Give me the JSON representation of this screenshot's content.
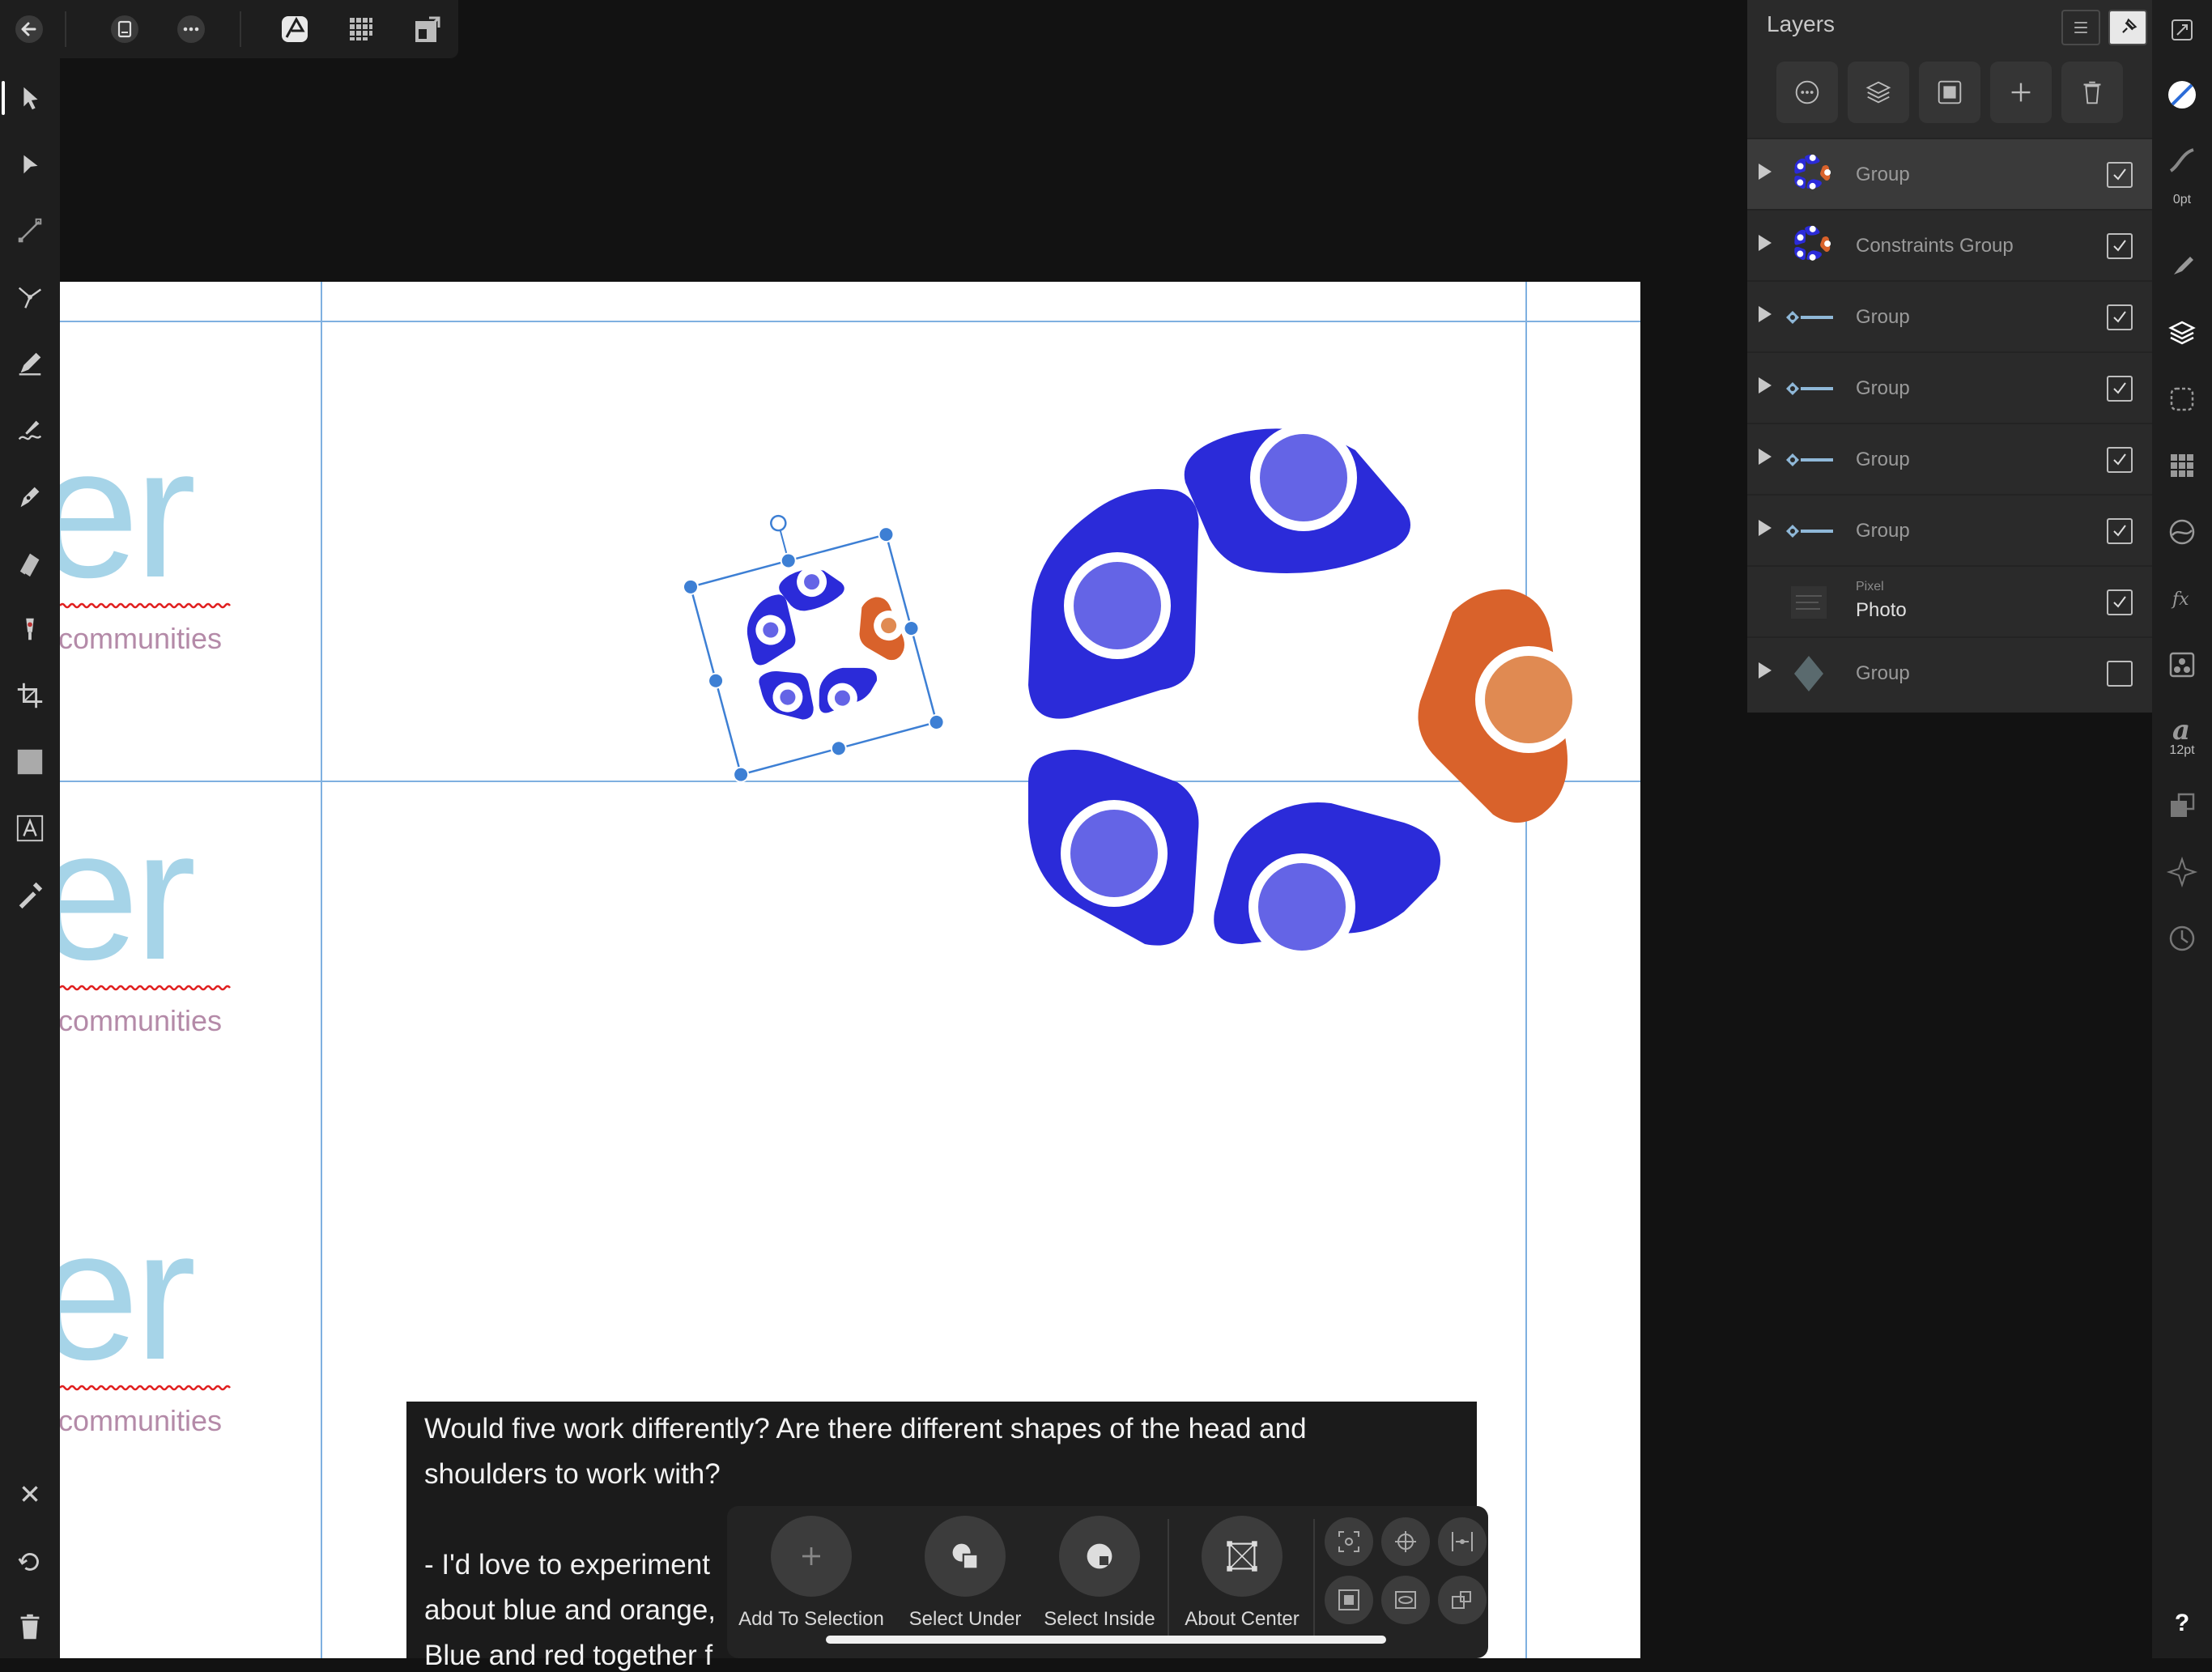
{
  "app": {
    "accent": "#4a86d8",
    "canvas_bg": "#121212",
    "brand_blue": "#2b2bd9",
    "brand_orange": "#d9622b"
  },
  "topbar": {
    "icons": [
      "back-arrow-icon",
      "document-icon",
      "more-icon",
      "affinity-persona-icon",
      "pixel-grid-icon",
      "export-persona-icon"
    ]
  },
  "left_tools": [
    "move-tool",
    "node-tool",
    "corner-tool",
    "point-transform-tool",
    "pencil-tool",
    "vector-brush-tool",
    "pen-tool",
    "fill-tool",
    "transparency-tool",
    "crop-tool",
    "rectangle-tool",
    "text-tool",
    "color-picker-tool",
    "close-icon",
    "undo-icon",
    "trash-icon"
  ],
  "canvas": {
    "text_er": "er",
    "text_communities": "communities"
  },
  "note": {
    "lines": [
      "Would five work differently? Are there different shapes of the head and",
      "shoulders to work with?",
      "",
      "- I'd love to experiment",
      "about blue and orange,",
      "Blue and red together f"
    ]
  },
  "selection_bar": {
    "items": [
      {
        "label": "Add To Selection",
        "icon": "plus-icon"
      },
      {
        "label": "Select Under",
        "icon": "select-under-icon"
      },
      {
        "label": "Select Inside",
        "icon": "select-inside-icon"
      },
      {
        "label": "About Center",
        "icon": "about-center-icon"
      }
    ]
  },
  "layers": {
    "title": "Layers",
    "rows": [
      {
        "name": "Group",
        "checked": true,
        "selected": true,
        "thumb": "logo"
      },
      {
        "name": "Constraints Group",
        "checked": true,
        "selected": false,
        "thumb": "logo"
      },
      {
        "name": "Group",
        "checked": true,
        "selected": false,
        "thumb": "empower"
      },
      {
        "name": "Group",
        "checked": true,
        "selected": false,
        "thumb": "empower"
      },
      {
        "name": "Group",
        "checked": true,
        "selected": false,
        "thumb": "empower"
      },
      {
        "name": "Group",
        "checked": true,
        "selected": false,
        "thumb": "empower"
      },
      {
        "type": "Pixel",
        "name": "Photo",
        "checked": true,
        "selected": false,
        "thumb": "photo"
      },
      {
        "name": "Group",
        "checked": false,
        "selected": false,
        "thumb": "diamond"
      }
    ]
  },
  "right_bar": {
    "stroke_label": "0pt",
    "font_size_label": "12pt",
    "help": "?"
  }
}
